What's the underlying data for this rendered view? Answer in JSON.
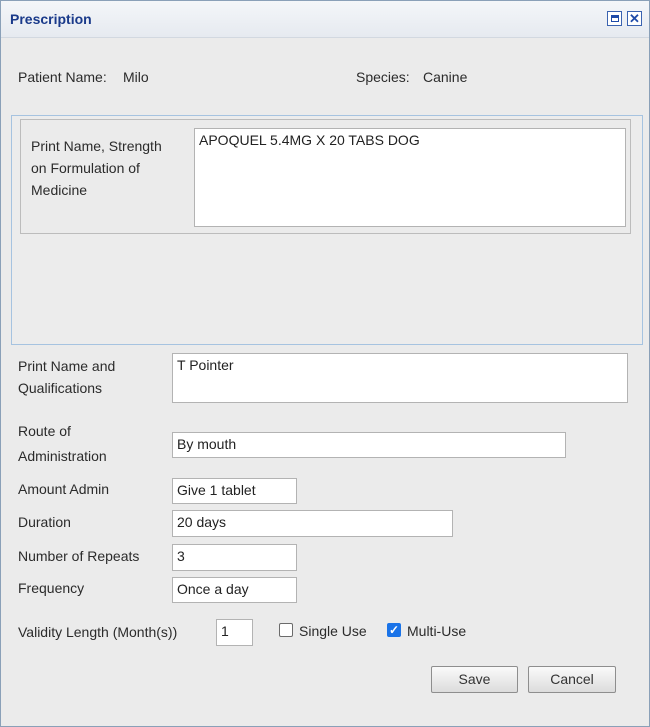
{
  "dialog": {
    "title": "Prescription"
  },
  "patient": {
    "name_label": "Patient Name:",
    "name_value": "Milo",
    "species_label": "Species:",
    "species_value": "Canine"
  },
  "medicine": {
    "label_line1": "Print Name, Strength",
    "label_line2": "on Formulation of",
    "label_line3": "Medicine",
    "value": "APOQUEL 5.4MG X 20 TABS DOG"
  },
  "form": {
    "qualifications": {
      "label_line1": "Print Name and",
      "label_line2": "Qualifications",
      "value": "T Pointer"
    },
    "route": {
      "label_line1": "Route of",
      "label_line2": "Administration",
      "value": "By mouth"
    },
    "amount": {
      "label": "Amount Admin",
      "value": "Give 1 tablet"
    },
    "duration": {
      "label": "Duration",
      "value": "20 days"
    },
    "repeats": {
      "label": "Number of Repeats",
      "value": "3"
    },
    "frequency": {
      "label": "Frequency",
      "value": "Once a day"
    },
    "validity": {
      "label": "Validity Length (Month(s))",
      "value": "1"
    },
    "single_use": {
      "label": "Single Use",
      "checked": false
    },
    "multi_use": {
      "label": "Multi-Use",
      "checked": true
    }
  },
  "buttons": {
    "save": "Save",
    "cancel": "Cancel"
  }
}
